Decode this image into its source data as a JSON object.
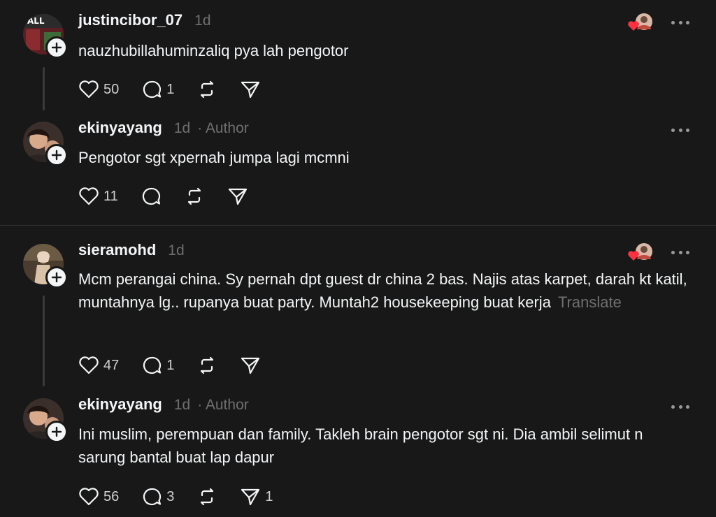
{
  "posts": [
    {
      "username": "justincibor_07",
      "time": "1d",
      "author_badge": "",
      "text": "nauzhubillahuminzaliq pya lah pengotor",
      "translate": "",
      "likes": "50",
      "replies": "1",
      "reposts": "",
      "shares": ""
    },
    {
      "username": "ekinyayang",
      "time": "1d",
      "author_badge": "· Author",
      "text": "Pengotor sgt xpernah jumpa lagi mcmni",
      "translate": "",
      "likes": "11",
      "replies": "",
      "reposts": "",
      "shares": ""
    },
    {
      "username": "sieramohd",
      "time": "1d",
      "author_badge": "",
      "text": "Mcm perangai china. Sy pernah dpt guest dr china 2 bas. Najis atas karpet, darah kt katil, muntahnya lg.. rupanya buat party. Muntah2 housekeeping buat kerja",
      "translate": "Translate",
      "likes": "47",
      "replies": "1",
      "reposts": "",
      "shares": ""
    },
    {
      "username": "ekinyayang",
      "time": "1d",
      "author_badge": "· Author",
      "text": "Ini muslim, perempuan dan family. Takleh brain pengotor sgt ni. Dia ambil selimut n sarung bantal buat lap dapur",
      "translate": "",
      "likes": "56",
      "replies": "3",
      "reposts": "",
      "shares": "1"
    }
  ],
  "icons": {
    "like": "heart-icon",
    "reply": "comment-icon",
    "repost": "repost-icon",
    "share": "send-icon",
    "more": "more-icon",
    "follow": "plus-icon",
    "liked_by_author": "liked-by-author-icon"
  },
  "colors": {
    "background": "#181818",
    "text": "#f3f5f7",
    "muted": "#6f6f6f",
    "heart": "#ff3040"
  }
}
